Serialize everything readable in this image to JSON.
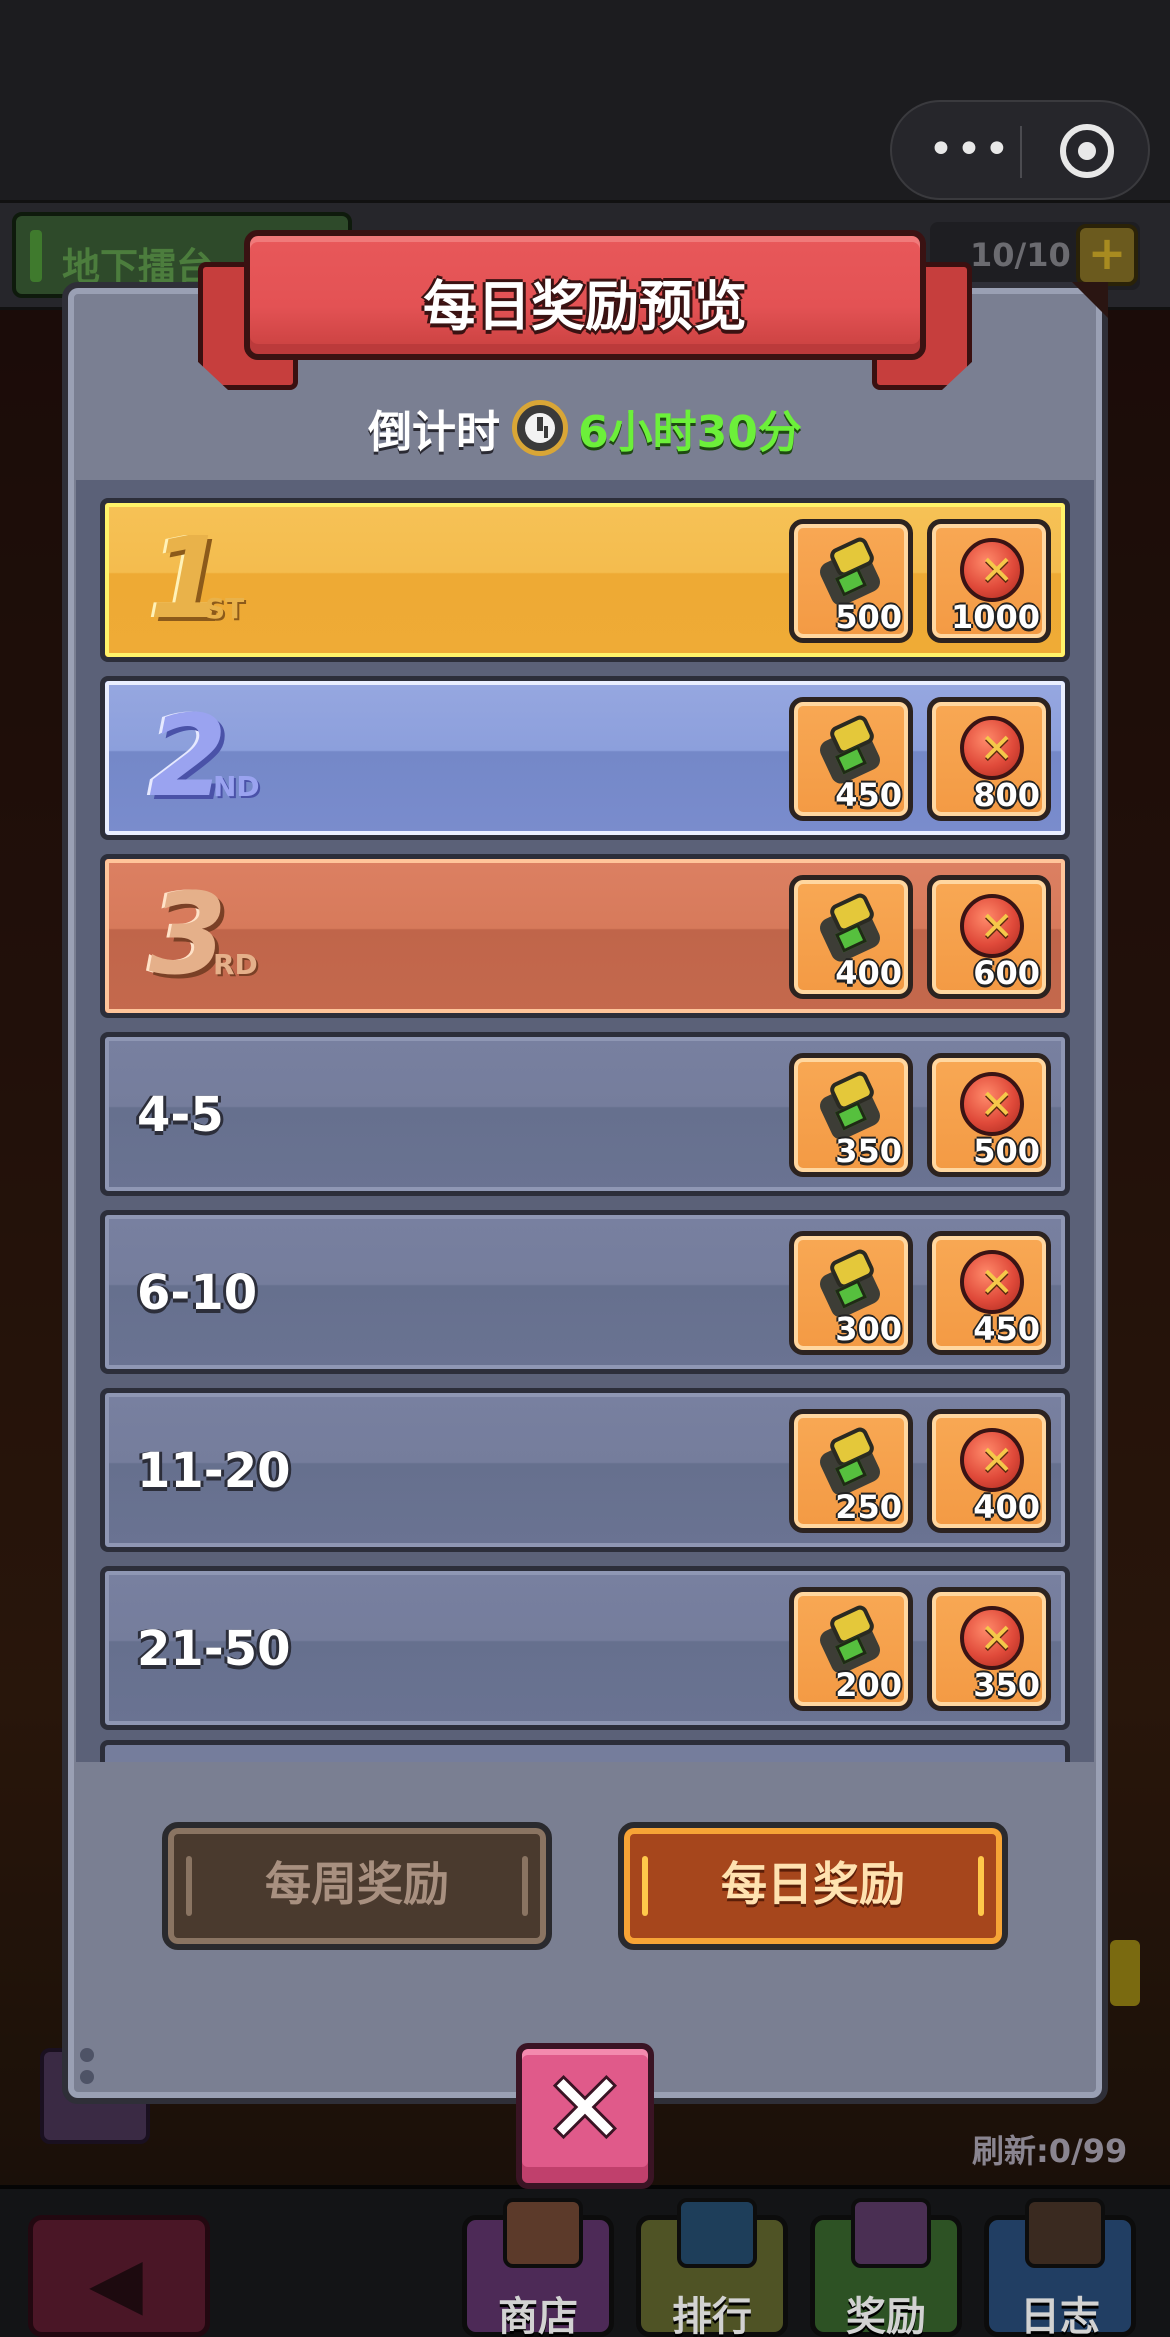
{
  "background": {
    "arena_title": "地下擂台",
    "energy": "10/10",
    "energy_plus": "+",
    "refresh": "刷新:0/99",
    "nav": {
      "shop": "商店",
      "rank": "排行",
      "reward": "奖励",
      "log": "日志",
      "back_icon": "left-arrow-icon"
    }
  },
  "capsule": {
    "more_icon": "more-dots-icon",
    "close_icon": "mini-program-close-icon",
    "dots": "•••"
  },
  "modal": {
    "title": "每日奖励预览",
    "countdown_label": "倒计时",
    "countdown_value": "6小时30分",
    "ranks": [
      {
        "label": "1",
        "suffix": "ST",
        "style": "gold",
        "reward1": "500",
        "reward2": "1000"
      },
      {
        "label": "2",
        "suffix": "ND",
        "style": "silver",
        "reward1": "450",
        "reward2": "800"
      },
      {
        "label": "3",
        "suffix": "RD",
        "style": "bronze",
        "reward1": "400",
        "reward2": "600"
      },
      {
        "label": "4-5",
        "style": "plain",
        "reward1": "350",
        "reward2": "500"
      },
      {
        "label": "6-10",
        "style": "plain",
        "reward1": "300",
        "reward2": "450"
      },
      {
        "label": "11-20",
        "style": "plain",
        "reward1": "250",
        "reward2": "400"
      },
      {
        "label": "21-50",
        "style": "plain",
        "reward1": "200",
        "reward2": "350"
      }
    ],
    "tabs": {
      "weekly": "每周奖励",
      "daily": "每日奖励",
      "active": "daily"
    },
    "close": "✕"
  },
  "colors": {
    "gold": "#f4bc4e",
    "silver": "#8c9fdc",
    "bronze": "#d77a5b",
    "plain": "#757d9c",
    "countdown": "#6cf03a"
  }
}
